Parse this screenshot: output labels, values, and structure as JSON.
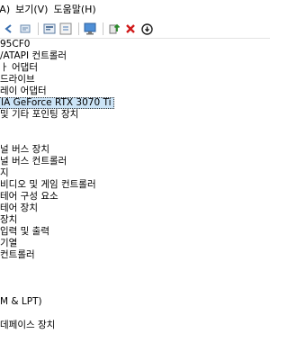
{
  "menubar": {
    "items": [
      "(A)",
      "보기(V)",
      "도움말(H)"
    ]
  },
  "toolbar": {
    "buttons": [
      "back-icon",
      "forward-icon",
      "properties-icon",
      "help-icon",
      "scan-icon",
      "monitor-icon",
      "update-driver-icon",
      "uninstall-icon",
      "disable-icon"
    ],
    "colors": {
      "delete": "#d01a1a",
      "update": "#2a8a2a",
      "disable": "#1e1e1e"
    }
  },
  "tree": {
    "items": [
      "95CF0",
      "/ATAPI 컨트롤러",
      "ㅏ 어댑터",
      "드라이브",
      "레이 어댑터",
      "IA GeForce RTX 3070 Ti",
      "및 기타 포인팅 장치",
      "",
      "",
      "널 버스 장치",
      "널 버스 컨트롤러",
      "지",
      "비디오 및 게임 컨트롤러",
      "테어 구성 요소",
      "테어 장치",
      "장치",
      "입력 및 출력",
      "기열",
      "컨트롤러",
      "",
      "",
      "",
      "M & LPT)",
      "",
      "데페이스 장치",
      ""
    ],
    "selected_index": 5
  }
}
